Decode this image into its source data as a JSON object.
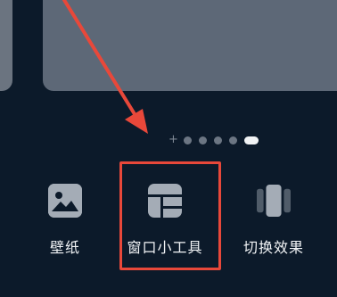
{
  "page_indicator": {
    "plus_glyph": "+",
    "dot_count": 5,
    "active_index": 4
  },
  "bottom_menu": {
    "items": [
      {
        "label": "壁纸",
        "icon": "wallpaper-icon"
      },
      {
        "label": "窗口小工具",
        "icon": "widget-icon"
      },
      {
        "label": "切换效果",
        "icon": "transition-effect-icon"
      }
    ]
  },
  "annotation": {
    "color": "#e8483a",
    "highlighted_item": "窗口小工具"
  },
  "colors": {
    "background": "#0c1a2a",
    "icon_fill": "#a4acb6",
    "label_text": "#f2f4f6",
    "active_dot": "#f1f3f5",
    "inactive_dot": "#6c7683"
  }
}
